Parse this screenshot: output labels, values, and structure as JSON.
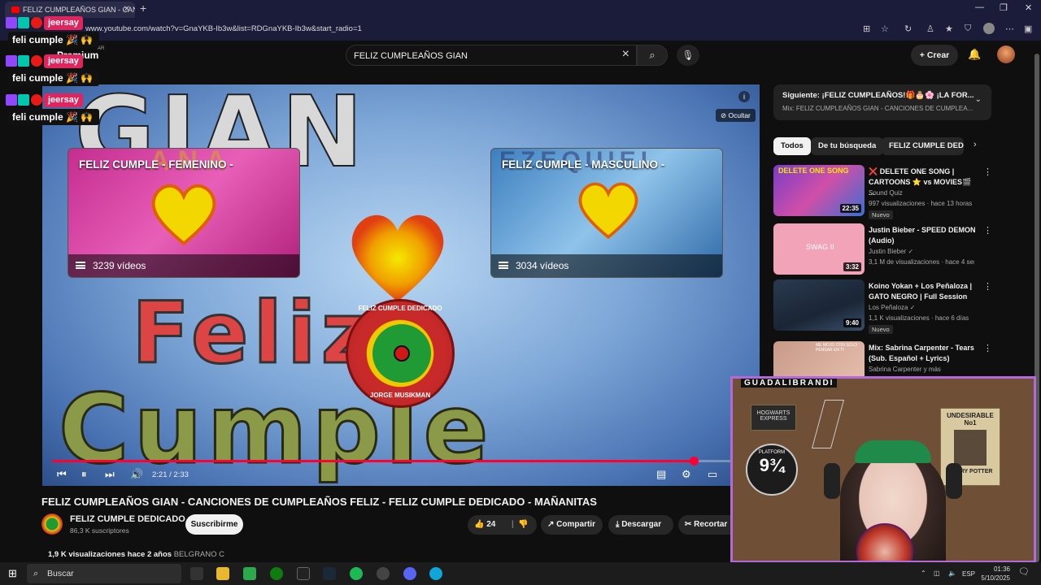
{
  "browser": {
    "tab_title": "FELIZ CUMPLEAÑOS GIAN - CAN",
    "tab_close": "✕",
    "new_tab": "+",
    "url": "www.youtube.com/watch?v=GnaYKB-Ib3w&list=RDGnaYKB-Ib3w&start_radio=1"
  },
  "youtube": {
    "premium_label": "Premium",
    "premium_country": "AR",
    "search_value": "FELIZ CUMPLEAÑOS GIAN",
    "create_label": "Crear"
  },
  "video": {
    "big_title": "GIAN",
    "big_feliz": "Feliz",
    "big_cumple": "Cumple",
    "emblem_top": "FELIZ CUMPLE DEDICADO",
    "emblem_bottom": "JORGE MUSIKMAN",
    "hide_label": "Ocultar",
    "info_icon": "i",
    "time": "2:21 / 2:33",
    "progress_fraction": 0.92,
    "cards": [
      {
        "title": "FELIZ CUMPLE - FEMENINO -",
        "count": "3239 vídeos",
        "bg_name": "ANA"
      },
      {
        "title": "FELIZ CUMPLE - MASCULINO -",
        "count": "3034 vídeos",
        "bg_name": "EZEQUIEL"
      }
    ]
  },
  "details": {
    "title": "FELIZ CUMPLEAÑOS GIAN - CANCIONES DE CUMPLEAÑOS FELIZ - FELIZ CUMPLE DEDICADO - MAÑANITAS",
    "channel": "FELIZ CUMPLE DEDICADO",
    "subscribers": "86,3 K suscriptores",
    "subscribe_label": "Suscribirme",
    "likes": "24",
    "share_label": "Compartir",
    "download_label": "Descargar",
    "clip_label": "Recortar",
    "views_date": "1,9 K visualizaciones  hace 2 años",
    "location": "BELGRANO C"
  },
  "sidebar": {
    "next_line1": "Siguiente: ¡FELIZ CUMPLEAÑOS!🎁🎂🌸 ¡LA FOR...",
    "next_line2": "Mix: FELIZ CUMPLEAÑOS GIAN - CANCIONES DE CUMPLEA...",
    "chips": [
      "Todos",
      "De tu búsqueda",
      "FELIZ CUMPLE DEDIC"
    ],
    "recs": [
      {
        "title": "❌ DELETE ONE SONG | CARTOONS ⭐ vs MOVIES🎬 ...",
        "channel": "Sound Quiz",
        "meta": "997 visualizaciones · hace 13 horas",
        "duration": "22:35",
        "badge": "Nuevo",
        "thumb_text": "DELETE ONE SONG"
      },
      {
        "title": "Justin Bieber - SPEED DEMON (Audio)",
        "channel": "Justin Bieber ✓",
        "meta": "3,1 M de visualizaciones · hace 4 seman...",
        "duration": "3:32",
        "badge": "",
        "thumb_text": "SWAG II"
      },
      {
        "title": "Koino Yokan + Los Peñaloza | GATO NEGRO | Full Session",
        "channel": "Los Peñaloza ✓",
        "meta": "1,1 K visualizaciones · hace 6 días",
        "duration": "9:40",
        "badge": "Nuevo",
        "thumb_text": ""
      },
      {
        "title": "Mix: Sabrina Carpenter - Tears (Sub. Español + Lyrics)",
        "channel": "Sabrina Carpenter y más",
        "meta": "",
        "duration": "",
        "badge": "",
        "thumb_text": "ME MOJO CON SOLO PENSAR EN TI"
      }
    ]
  },
  "overlay": {
    "chat": [
      {
        "user": "jeersay",
        "message": "feli cumple 🎉 🙌"
      },
      {
        "user": "jeersay",
        "message": "feli cumple 🎉 🙌"
      },
      {
        "user": "jeersay",
        "message": "feli cumple 🎉 🙌"
      }
    ],
    "cam_label": "GUADALIBRANDI",
    "poster_title": "UNDESIRABLE No1",
    "poster_name": "HARRY POTTER",
    "platform": "9¾",
    "hogwarts": "HOGWARTS EXPRESS",
    "platform_label": "PLATFORM"
  },
  "taskbar": {
    "search_label": "Buscar",
    "lang": "ESP",
    "time": "01:36",
    "date": "5/10/2025"
  },
  "colors": {
    "youtube_red": "#ff0033",
    "badge_pink": "#e0245e",
    "cam_border": "#b36ad8"
  }
}
